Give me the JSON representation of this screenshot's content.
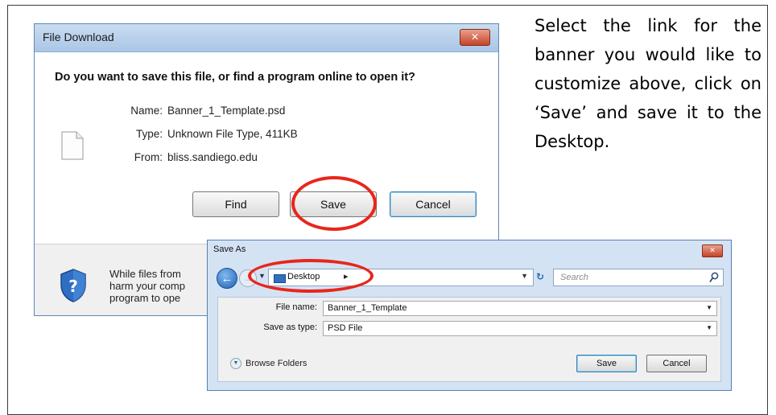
{
  "file_download": {
    "title": "File Download",
    "close_label": "✕",
    "question": "Do you want to save this file, or find a program online to open it?",
    "name_label": "Name:",
    "name_value": "Banner_1_Template.psd",
    "type_label": "Type:",
    "type_value": "Unknown File Type, 411KB",
    "from_label": "From:",
    "from_value": "bliss.sandiego.edu",
    "buttons": {
      "find": "Find",
      "save": "Save",
      "cancel": "Cancel"
    },
    "warning_lines": [
      "While files from",
      "harm your comp",
      "program to ope"
    ]
  },
  "instruction": "Select the link for the banner you would like to customize above, click on ‘Save’ and save it to the Desktop.",
  "save_as": {
    "title": "Save As",
    "close_label": "✕",
    "location": "Desktop",
    "search_placeholder": "Search",
    "file_name_label": "File name:",
    "file_name_value": "Banner_1_Template",
    "save_type_label": "Save as type:",
    "save_type_value": "PSD File",
    "browse_folders": "Browse Folders",
    "buttons": {
      "save": "Save",
      "cancel": "Cancel"
    }
  },
  "colors": {
    "highlight_ring": "#e8261a",
    "titlebar": "#aac6e6",
    "close_button": "#c4442a"
  },
  "icons": [
    "file-icon",
    "shield-question-icon",
    "back-arrow-icon",
    "forward-arrow-icon",
    "folder-icon",
    "refresh-icon",
    "search-icon",
    "chevron-down-icon"
  ]
}
